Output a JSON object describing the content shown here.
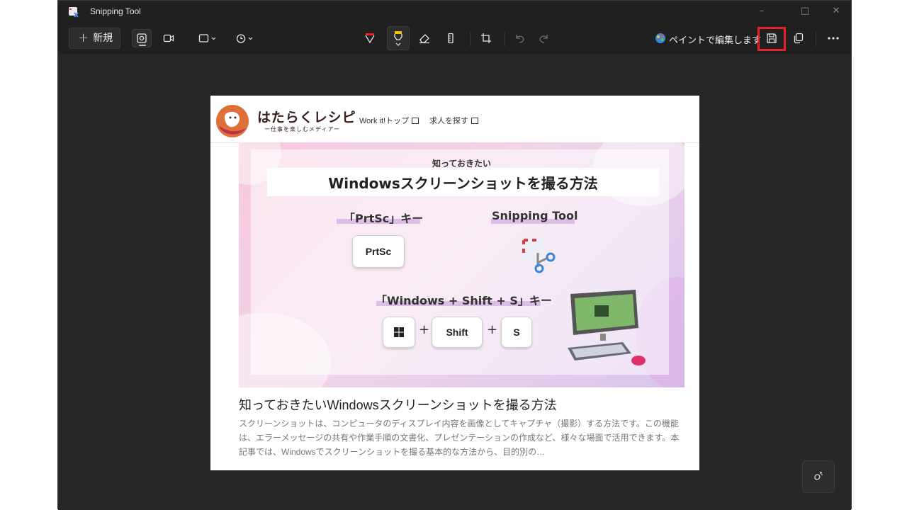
{
  "window": {
    "title": "Snipping Tool",
    "controls": {
      "minimize": "–",
      "maximize": "□",
      "close": "✕"
    }
  },
  "toolbar": {
    "new_label": "新規",
    "new_icon": "plus-icon",
    "paint_edit_label": "ペイントで編集します",
    "icons": [
      "camera-icon",
      "video-icon",
      "rectangle-snip-icon",
      "timer-icon",
      "ballpoint-pen-icon",
      "highlighter-icon",
      "eraser-icon",
      "ruler-icon",
      "crop-icon",
      "undo-icon",
      "redo-icon",
      "paint-icon",
      "save-icon",
      "copy-icon",
      "more-icon"
    ],
    "accent_red": "#e8202a",
    "accent_yellow": "#f5c400"
  },
  "capture": {
    "site": {
      "logo_text": "はたらくレシピ",
      "logo_sub": "ー仕事を楽しむメディアー",
      "nav": [
        "Work it!トップ",
        "求人を探す"
      ]
    },
    "banner": {
      "kicker": "知っておきたい",
      "title": "Windowsスクリーンショットを撮る方法",
      "method1": "「PrtSc」キー",
      "method2": "Snipping Tool",
      "method3": "「Windows + Shift + S」キー",
      "key_prtsc": "PrtSc",
      "key_shift": "Shift",
      "key_s": "S",
      "plus": "+"
    },
    "article": {
      "title": "知っておきたいWindowsスクリーンショットを撮る方法",
      "description": "スクリーンショットは、コンピュータのディスプレイ内容を画像としてキャプチャ（撮影）する方法です。この機能は、エラーメッセージの共有や作業手順の文書化、プレゼンテーションの作成など、様々な場面で活用できます。本記事では、Windowsでスクリーンショットを撮る基本的な方法から、目的別の…"
    }
  }
}
